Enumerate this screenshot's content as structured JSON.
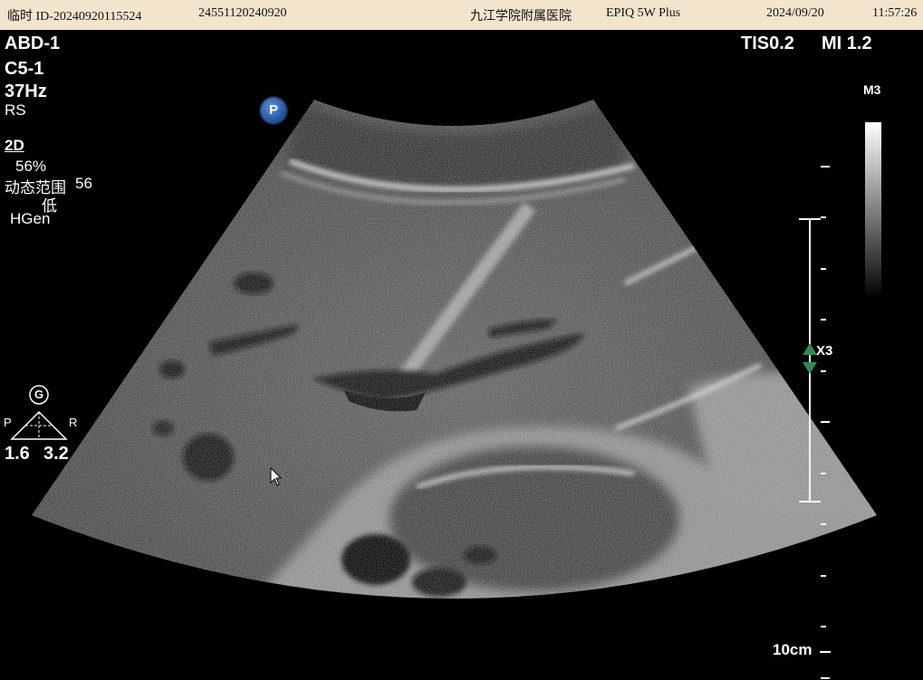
{
  "header": {
    "temp_id": "临时 ID-20240920115524",
    "accession": "24551120240920",
    "hospital": "九江学院附属医院",
    "system": "EPIQ 5W Plus",
    "date": "2024/09/20",
    "time": "11:57:26"
  },
  "left_info": {
    "preset": "ABD-1",
    "probe": "C5-1",
    "frame_rate": "37Hz",
    "rs": "RS",
    "mode": "2D",
    "gain": "56%",
    "dynamic_range_label": "动态范围",
    "dynamic_range_value": "56",
    "persistence": "低",
    "harmonics": "HGen"
  },
  "right_info": {
    "tis": "TIS0.2",
    "mi": "MI 1.2",
    "map": "M3",
    "zoom": "X3",
    "depth": "10cm"
  },
  "probe_orientation": {
    "g": "G",
    "p": "P",
    "r": "R",
    "left_value": "1.6",
    "right_value": "3.2"
  },
  "badge": "P",
  "colors": {
    "header_bg": "#f2e5cc",
    "focus_arrow": "#2e8b4f",
    "badge_blue": "#1f4f9e"
  }
}
